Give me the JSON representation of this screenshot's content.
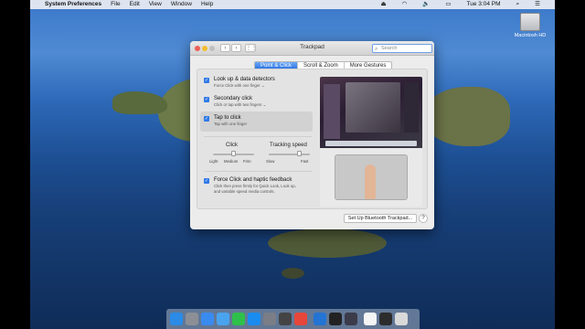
{
  "menubar": {
    "app": "System Preferences",
    "items": [
      "File",
      "Edit",
      "View",
      "Window",
      "Help"
    ],
    "clock": "Tue 3:04 PM"
  },
  "desktop": {
    "drive_label": "Macintosh HD"
  },
  "window": {
    "title": "Trackpad",
    "search_placeholder": "Search",
    "tabs": [
      {
        "label": "Point & Click",
        "active": true
      },
      {
        "label": "Scroll & Zoom",
        "active": false
      },
      {
        "label": "More Gestures",
        "active": false
      }
    ],
    "options": [
      {
        "label": "Look up & data detectors",
        "sub": "Force Click with one finger ⌄",
        "checked": true
      },
      {
        "label": "Secondary click",
        "sub": "Click or tap with two fingers ⌄",
        "checked": true
      },
      {
        "label": "Tap to click",
        "sub": "Tap with one finger",
        "checked": true
      }
    ],
    "click": {
      "label": "Click",
      "ticks": [
        "Light",
        "Medium",
        "Firm"
      ],
      "value": "Medium"
    },
    "tracking": {
      "label": "Tracking speed",
      "ticks": [
        "Slow",
        "Fast"
      ],
      "value": 0.75
    },
    "force": {
      "label": "Force Click and haptic feedback",
      "sub1": "Click then press firmly for Quick Look, Look up,",
      "sub2": "and variable speed media controls.",
      "checked": true
    },
    "bt_button": "Set Up Bluetooth Trackpad...",
    "help": "?"
  },
  "dock": {
    "icons": [
      "finder-icon",
      "launchpad-icon",
      "safari-icon",
      "mail-icon",
      "numbers-icon",
      "app-store-icon",
      "system-preferences-icon",
      "photo-icon",
      "chrome-icon",
      "vscode-icon",
      "terminal-icon",
      "screen-icon",
      "notes-icon",
      "keyboard-icon",
      "trash-icon"
    ],
    "colors": [
      "#2b8be6",
      "#8d8f96",
      "#3a8bf0",
      "#4aa3ef",
      "#2ec04a",
      "#1a8cf0",
      "#7b7e86",
      "#444",
      "#e7463a",
      "#2374d4",
      "#222",
      "#3b3b4a",
      "#f5f5f5",
      "#2c2c2c",
      "#d9d9d9"
    ]
  }
}
